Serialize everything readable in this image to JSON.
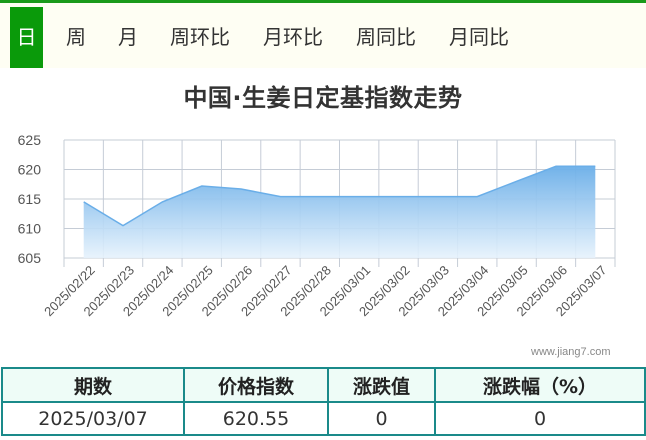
{
  "tabs": [
    {
      "label": "日",
      "active": true
    },
    {
      "label": "周",
      "active": false
    },
    {
      "label": "月",
      "active": false
    },
    {
      "label": "周环比",
      "active": false
    },
    {
      "label": "月环比",
      "active": false
    },
    {
      "label": "周同比",
      "active": false
    },
    {
      "label": "月同比",
      "active": false
    }
  ],
  "watermark": "www.jiang7.com",
  "chart_data": {
    "type": "area",
    "title": "中国·生姜日定基指数走势",
    "x": [
      "2025/02/22",
      "2025/02/23",
      "2025/02/24",
      "2025/02/25",
      "2025/02/26",
      "2025/02/27",
      "2025/02/28",
      "2025/03/01",
      "2025/03/02",
      "2025/03/03",
      "2025/03/04",
      "2025/03/05",
      "2025/03/06",
      "2025/03/07"
    ],
    "series": [
      {
        "values": [
          614.5,
          610.5,
          614.5,
          617.2,
          616.7,
          615.4,
          615.4,
          615.4,
          615.4,
          615.4,
          615.4,
          618.0,
          620.55,
          620.55
        ]
      }
    ],
    "yticks": [
      605,
      610,
      615,
      620,
      625
    ],
    "ylim": [
      605,
      625
    ],
    "grid": true,
    "colors": {
      "fill_top": "#6aaee8",
      "fill_bottom": "#e6f2fc",
      "line": "#6aaee8",
      "grid": "#c5ccd6"
    }
  },
  "table": {
    "headers": [
      "期数",
      "价格指数",
      "涨跌值",
      "涨跌幅（%）"
    ],
    "row": [
      "2025/03/07",
      "620.55",
      "0",
      "0"
    ]
  }
}
